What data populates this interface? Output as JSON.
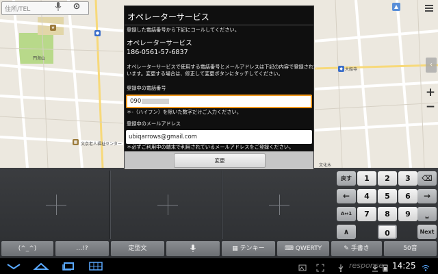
{
  "map": {
    "search_placeholder": "住所/TEL",
    "labels": {
      "park": "円海山",
      "landmark_right": "大船寺",
      "landmark_bottom": "文京老人福祉センター",
      "area_bottom_right": "文化木"
    }
  },
  "dialog": {
    "title": "オペレーターサービス",
    "intro": "登録した電話番号から下記にコールしてください。",
    "service_name": "オペレーターサービス",
    "service_number": "186-0561-57-6837",
    "description_line1": "オペレーターサービスで使用する電話番号とメールアドレスは下記の内容で登録されて",
    "description_line2": "います。変更する場合は、修正して変更ボタンにタッチしてください。",
    "phone_label": "登録中の電話番号",
    "phone_value": "090",
    "phone_note": "＊-（ハイフン）を除いた数字だけご入力ください。",
    "email_label": "登録中のメールアドレス",
    "email_value": "ubiqarrows@gmail.com",
    "email_note": "＊必ずご利用中の端末で利用されているメールアドレスをご登録ください。",
    "change_button": "変更"
  },
  "keyboard": {
    "back_key": "戻す",
    "delete_key": "⌫",
    "left_key": "←",
    "right_key": "→",
    "up_key": "∧",
    "space_key": "⎵",
    "next_key": "Next",
    "case_key": "A↔1",
    "digits": [
      "1",
      "2",
      "3",
      "4",
      "5",
      "6",
      "7",
      "8",
      "9",
      "0"
    ],
    "bottom_bar": [
      "(^_^)",
      "…!?",
      "定型文",
      "🎤",
      "テンキー",
      "QWERTY",
      "手書き",
      "50音"
    ]
  },
  "system": {
    "clock": "14:25",
    "watermark": "response"
  },
  "colors": {
    "accent_orange": "#f39a1e",
    "dialog_bg": "#0f0f0f",
    "map_bg": "#ece8df"
  }
}
